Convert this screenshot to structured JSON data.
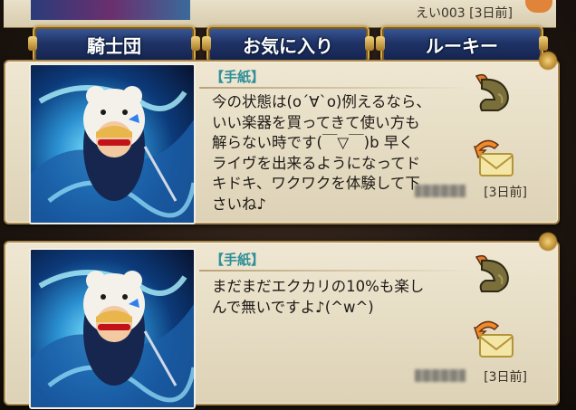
{
  "previous_card": {
    "meta": "えい003 [3日前]"
  },
  "tabs": [
    {
      "label": "騎士団"
    },
    {
      "label": "お気に入り"
    },
    {
      "label": "ルーキー"
    }
  ],
  "messages": [
    {
      "header": "【手紙】",
      "body": "今の状態は(o´∀`o)例えるなら、\nいい楽器を買ってきて使い方も\n解らない時です(￣▽￣)b 早く\nライヴを出来るようになってド\nキドキ、ワクワクを体験して下\nさいね♪",
      "date": "[3日前]",
      "like_icon": "flexed-arm-icon",
      "reply_icon": "reply-envelope-icon"
    },
    {
      "header": "【手紙】",
      "body": "まだまだエクカリの10%も楽し\nんで無いですよ♪(^w^)",
      "date": "[3日前]",
      "like_icon": "flexed-arm-icon",
      "reply_icon": "reply-envelope-icon"
    }
  ],
  "colors": {
    "tab_fill": "#1f3366",
    "tab_border": "#d2a84c",
    "card_bg": "#efe7d2",
    "header_text": "#2f8f9a",
    "body_text": "#1e1a16"
  }
}
